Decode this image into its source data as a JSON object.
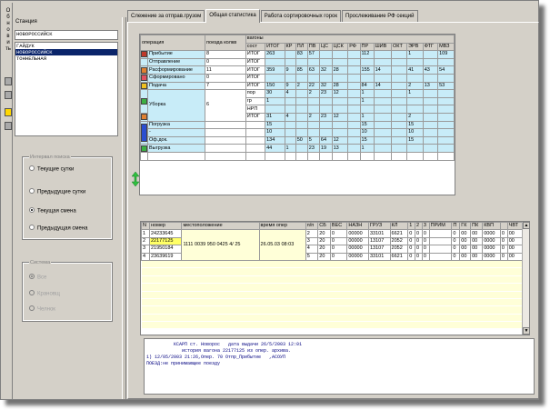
{
  "sidebar_vertical_text": "Обновить",
  "left": {
    "station_label": "Станция",
    "stations": [
      "НОВОРОССИЙСК",
      "ГАЙДУК",
      "НОВОРОССИЙСК",
      "ТОННЕЛЬНАЯ"
    ],
    "selected_station_index": 2,
    "interval_group_title": "Интервал поиска",
    "interval_options": [
      "Текущие сутки",
      "Предыдущие сутки",
      "Текущая смена",
      "Предыдущая смена"
    ],
    "interval_selected": 2,
    "system_group_title": "Система",
    "system_options": [
      "Все",
      "Крановщ",
      "Челнок"
    ],
    "system_selected": 0
  },
  "tabs": [
    "Слежение за отправ.грузом",
    "Общая статистика",
    "Работа сортировочных горок",
    "Прослеживание РФ секций"
  ],
  "active_tab": 1,
  "top_table": {
    "group_header": "вагоны",
    "headers": [
      "операция",
      "поезда колкв",
      "сост",
      "ИТОГ",
      "КР",
      "ПЛ",
      "ПВ",
      "ЦС",
      "ЦСК",
      "РФ",
      "ПР",
      "ШИВ",
      "ОКТ",
      "ЭРВ",
      "ФТГ",
      "МВЗ"
    ],
    "rows": [
      {
        "op": "Прибытие",
        "icon": "red",
        "trains": "8",
        "sost": "ИТОГ",
        "vals": [
          "263",
          "",
          "83",
          "57",
          "",
          "",
          "",
          "112",
          "",
          "",
          "1",
          "",
          "109"
        ]
      },
      {
        "op": "Отправление",
        "icon": "",
        "trains": "0",
        "sost": "ИТОГ",
        "vals": [
          "",
          "",
          "",
          "",
          "",
          "",
          "",
          "",
          "",
          "",
          "",
          "",
          ""
        ]
      },
      {
        "op": "Расформирование",
        "icon": "orange",
        "trains": "11",
        "sost": "ИТОГ",
        "vals": [
          "359",
          "9",
          "85",
          "63",
          "32",
          "28",
          "",
          "155",
          "14",
          "",
          "41",
          "43",
          "54"
        ]
      },
      {
        "op": "Сформировано",
        "icon": "pink",
        "trains": "0",
        "sost": "ИТОГ",
        "vals": [
          "",
          "",
          "",
          "",
          "",
          "",
          "",
          "",
          "",
          "",
          "",
          "",
          ""
        ]
      },
      {
        "op": "Подача",
        "icon": "yellow",
        "trains": "7",
        "sost": "ИТОГ",
        "vals": [
          "150",
          "9",
          "2",
          "22",
          "32",
          "28",
          "",
          "84",
          "14",
          "",
          "2",
          "13",
          "53"
        ]
      }
    ],
    "uborka": {
      "op": "Уборка",
      "trains": "6",
      "sub": [
        {
          "sost": "пор",
          "vals": [
            "30",
            "4",
            "",
            "2",
            "23",
            "12",
            "",
            "1",
            "",
            "",
            "1",
            "",
            ""
          ]
        },
        {
          "sost": "гр",
          "vals": [
            "1",
            "",
            "",
            "",
            "",
            "",
            "",
            "1",
            "",
            "",
            "",
            "",
            ""
          ]
        },
        {
          "sost": "НРП",
          "vals": [
            "",
            "",
            "",
            "",
            "",
            "",
            "",
            "",
            "",
            "",
            "",
            "",
            ""
          ]
        },
        {
          "sost": "ИТОГ",
          "vals": [
            "31",
            "4",
            "",
            "2",
            "23",
            "12",
            "",
            "1",
            "",
            "",
            "2",
            "",
            ""
          ]
        }
      ]
    },
    "pogruzka": [
      {
        "op": "Погрузка",
        "vals": [
          "15",
          "",
          "",
          "",
          "",
          "",
          "",
          "15",
          "",
          "",
          "15",
          "",
          ""
        ]
      },
      {
        "op": "-",
        "vals": [
          "10",
          "",
          "",
          "",
          "",
          "",
          "",
          "10",
          "",
          "",
          "10",
          "",
          ""
        ]
      },
      {
        "op": "Оф.док.",
        "vals": [
          "134",
          "",
          "50",
          "5",
          "64",
          "12",
          "",
          "15",
          "",
          "",
          "15",
          "",
          ""
        ]
      },
      {
        "op": "Выгрузка",
        "vals": [
          "44",
          "1",
          "",
          "23",
          "19",
          "13",
          "",
          "1",
          "",
          "",
          "",
          "",
          ""
        ]
      }
    ]
  },
  "bottom_table": {
    "headers": [
      "N",
      "номер",
      "местоположение",
      "время опер",
      "п/п",
      "СБ",
      "ВЕС",
      "НАЗН",
      "ГРУЗ",
      "КЛ",
      "1",
      "2",
      "3",
      "ПРИМ",
      "П",
      "ГК",
      "ПК",
      "КВП",
      "",
      "ЧВТ"
    ],
    "location": "1111 0039 950 0425 4/ 25",
    "op_time": "26.05.03 08:03",
    "rows": [
      {
        "n": "1",
        "num": "24233645",
        "pp": "2",
        "sb": "20",
        "ves": "0",
        "nazn": "00000",
        "gruz": "33101",
        "kl": "6621",
        "c1": "0",
        "c2": "0",
        "c3": "0",
        "prim": "",
        "p": "0",
        "gk": "00",
        "pk": "00",
        "kvp": "0000",
        "x": "0",
        "chvt": "00"
      },
      {
        "n": "2",
        "num": "22177125",
        "pp": "3",
        "sb": "20",
        "ves": "0",
        "nazn": "00000",
        "gruz": "13107",
        "kl": "2052",
        "c1": "0",
        "c2": "0",
        "c3": "0",
        "prim": "",
        "p": "0",
        "gk": "00",
        "pk": "00",
        "kvp": "0000",
        "x": "0",
        "chvt": "00"
      },
      {
        "n": "3",
        "num": "21950184",
        "pp": "4",
        "sb": "20",
        "ves": "0",
        "nazn": "00000",
        "gruz": "13107",
        "kl": "2052",
        "c1": "0",
        "c2": "0",
        "c3": "0",
        "prim": "",
        "p": "0",
        "gk": "00",
        "pk": "00",
        "kvp": "0000",
        "x": "0",
        "chvt": "00"
      },
      {
        "n": "4",
        "num": "23639619",
        "pp": "5",
        "sb": "20",
        "ves": "0",
        "nazn": "00000",
        "gruz": "33101",
        "kl": "6621",
        "c1": "0",
        "c2": "0",
        "c3": "0",
        "prim": "",
        "p": "0",
        "gk": "00",
        "pk": "00",
        "kvp": "0000",
        "x": "0",
        "chvt": "00"
      }
    ]
  },
  "console": {
    "line1": "          КСАРП ст. Новорос   дата выдачи 26/5/2003 12:01",
    "line2": "             история вагона 22177125 из опер. архива.",
    "line3": "",
    "line4": "1) 12/05/2003 21:26,Опер. 70 Отпр_Прибытие   ,АСОУП",
    "line5": "ПОЕЗД:не принимающее поезду"
  },
  "colors": {
    "highlight_yellow": "#ffff66",
    "cell_cyan": "#c8ecf8",
    "select_navy": "#0a246a",
    "console_text": "#000080"
  }
}
